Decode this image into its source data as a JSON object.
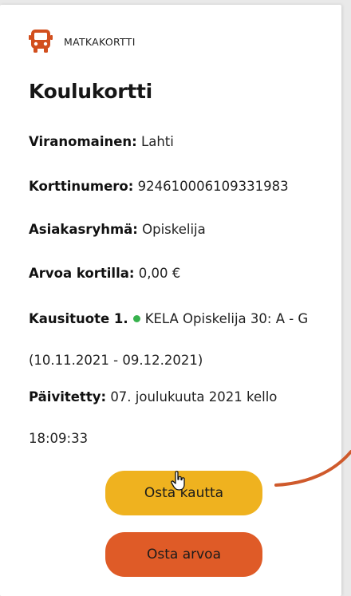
{
  "brand": {
    "label": "MATKAKORTTI",
    "icon": "bus-icon"
  },
  "title": "Koulukortti",
  "fields": [
    {
      "label": "Viranomainen:",
      "value": "Lahti"
    },
    {
      "label": "Korttinumero:",
      "value": "924610006109331983"
    },
    {
      "label": "Asiakasryhmä:",
      "value": "Opiskelija"
    },
    {
      "label": "Arvoa kortilla:",
      "value": "0,00 €"
    }
  ],
  "season_product": {
    "label": "Kausituote 1.",
    "value": "KELA Opiskelija 30: A - G (10.11.2021 - 09.12.2021)",
    "status_color": "#37b24d"
  },
  "updated": {
    "label": "Päivitetty:",
    "value": "07. joulukuuta 2021 kello 18:09:33"
  },
  "buttons": {
    "primary": "Osta kautta",
    "secondary": "Osta arvoa"
  },
  "colors": {
    "brand_icon": "#d24f1e",
    "primary_button": "#efb21f",
    "secondary_button": "#df5b27",
    "annotation": "#cf5a2c"
  }
}
